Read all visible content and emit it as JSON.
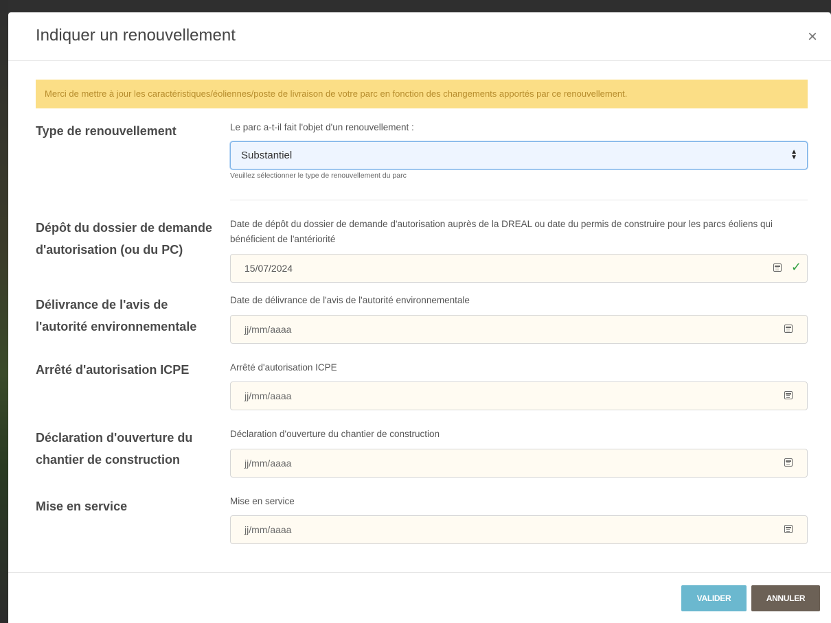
{
  "modal": {
    "title": "Indiquer un renouvellement",
    "close": "×"
  },
  "alert": {
    "text": "Merci de mettre à jour les caractéristiques/éoliennes/poste de livraison de votre parc en fonction des changements apportés par ce renouvellement."
  },
  "renewal_type": {
    "label": "Type de renouvellement",
    "question": "Le parc a-t-il fait l'objet d'un renouvellement :",
    "selected": "Substantiel",
    "help": "Veuillez sélectionner le type de renouvellement du parc"
  },
  "dates": [
    {
      "label": "Dépôt du dossier de demande d'autorisation (ou du PC)",
      "field_label": "Date de dépôt du dossier de demande d'autorisation auprès de la DREAL ou date du permis de construire pour les parcs éoliens qui bénéficient de l'antériorité",
      "value": "15/07/2024"
    },
    {
      "label": "Délivrance de l'avis de l'autorité environnementale",
      "field_label": "Date de délivrance de l'avis de l'autorité environnementale",
      "placeholder": "jj/mm/aaaa"
    },
    {
      "label": "Arrêté d'autorisation ICPE",
      "field_label": "Arrêté d'autorisation ICPE",
      "placeholder": "jj/mm/aaaa"
    },
    {
      "label": "Déclaration d'ouverture du chantier de construction",
      "field_label": "Déclaration d'ouverture du chantier de construction",
      "placeholder": "jj/mm/aaaa"
    },
    {
      "label": "Mise en service",
      "field_label": "Mise en service",
      "placeholder": "jj/mm/aaaa"
    }
  ],
  "footer": {
    "validate": "VALIDER",
    "cancel": "ANNULER"
  },
  "colors": {
    "alert_bg": "#fbde86",
    "alert_text": "#b78d2d",
    "validate_btn": "#6bb8cf",
    "cancel_btn": "#6c6156",
    "valid_check": "#2e9e3e"
  }
}
